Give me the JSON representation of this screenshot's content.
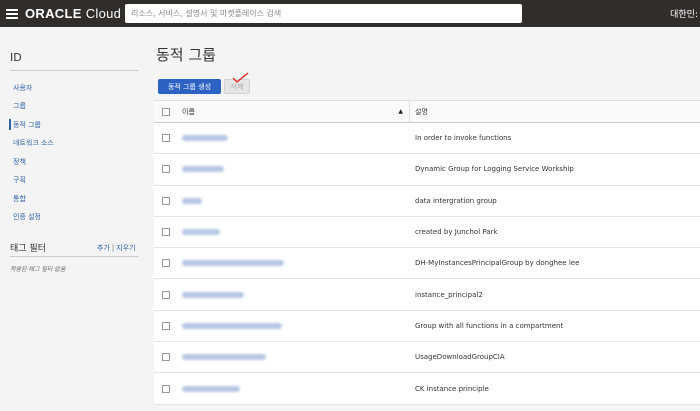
{
  "header": {
    "brand": "ORACLE",
    "product": "Cloud",
    "search_placeholder": "리소스, 서비스, 설명서 및 마켓플레이스 검색",
    "region": "대한민:"
  },
  "sidebar": {
    "title": "ID",
    "items": [
      {
        "label": "사용자"
      },
      {
        "label": "그룹"
      },
      {
        "label": "동적 그룹"
      },
      {
        "label": "네트워크 소스"
      },
      {
        "label": "정책"
      },
      {
        "label": "구획"
      },
      {
        "label": "통합"
      },
      {
        "label": "인증 설정"
      }
    ],
    "active_index": 2,
    "tag_filter": {
      "title": "태그 필터",
      "add": "추가",
      "separator": "|",
      "clear": "지우기",
      "empty": "적용된 태그 필터 없음"
    }
  },
  "main": {
    "title": "동적 그룹",
    "create_button": "동적 그룹 생성",
    "delete_button": "삭제",
    "table": {
      "col_name": "이름",
      "col_desc": "설명",
      "rows": [
        {
          "desc": "In order to invoke functions"
        },
        {
          "desc": "Dynamic Group for Logging Service Workship"
        },
        {
          "desc": "data intergration group"
        },
        {
          "desc": "created by Junchol Park"
        },
        {
          "desc": "DH-MyInstancesPrincipalGroup by donghee lee"
        },
        {
          "desc": "instance_principal2"
        },
        {
          "desc": "Group with all functions in a compartment"
        },
        {
          "desc": "UsageDownloadGroupCIA"
        },
        {
          "desc": "CK instance principle"
        }
      ]
    }
  },
  "colors": {
    "topbar": "#312d2a",
    "link": "#2b62a8",
    "primary_button": "#2b62c4",
    "annotation": "#e0201b"
  }
}
